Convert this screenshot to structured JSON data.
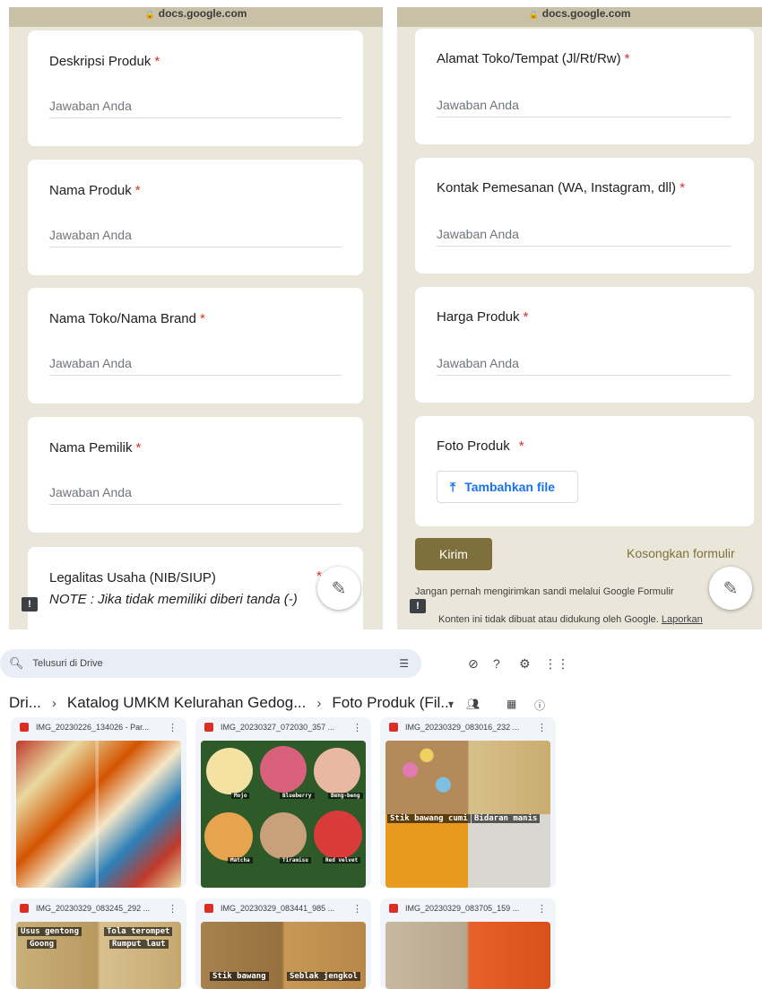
{
  "left_panel": {
    "url": "docs.google.com",
    "questions": [
      {
        "title": "Deskripsi Produk",
        "required": "*",
        "placeholder": "Jawaban Anda"
      },
      {
        "title": "Nama Produk",
        "required": "*",
        "placeholder": "Jawaban Anda"
      },
      {
        "title": "Nama Toko/Nama Brand",
        "required": "*",
        "placeholder": "Jawaban Anda"
      },
      {
        "title": "Nama Pemilik",
        "required": "*",
        "placeholder": "Jawaban Anda"
      }
    ],
    "legalitas": {
      "title": "Legalitas Usaha  (NIB/SIUP)",
      "required": "*",
      "note": "NOTE : Jika tidak memiliki diberi tanda (-)"
    }
  },
  "right_panel": {
    "url": "docs.google.com",
    "questions": [
      {
        "title": "Alamat Toko/Tempat (Jl/Rt/Rw)",
        "required": "*",
        "placeholder": "Jawaban Anda"
      },
      {
        "title": "Kontak Pemesanan (WA, Instagram, dll)",
        "required": "*",
        "placeholder": "Jawaban Anda"
      },
      {
        "title": "Harga Produk",
        "required": "*",
        "placeholder": "Jawaban Anda"
      }
    ],
    "foto": {
      "title": "Foto Produk",
      "required": "*",
      "button_label": "Tambahkan file"
    },
    "submit_label": "Kirim",
    "clear_label": "Kosongkan formulir",
    "footer_line1": "Jangan pernah mengirimkan sandi melalui Google Formulir",
    "footer_line2_text": "Konten ini tidak dibuat atau didukung oleh Google.",
    "footer_line2_link": "Laporkan"
  },
  "drive": {
    "search_placeholder": "Telusuri di Drive",
    "breadcrumb": [
      "Dri...",
      "Katalog UMKM Kelurahan Gedog...",
      "Foto Produk (Fil..."
    ],
    "files": [
      {
        "name": "IMG_20230226_134026 - Par...",
        "captions": []
      },
      {
        "name": "IMG_20230327_072030_357 ...",
        "captions": [
          "Mojo",
          "Blueberry",
          "Beng-beng",
          "Matcha",
          "Tiramisu",
          "Red velvet"
        ]
      },
      {
        "name": "IMG_20230329_083016_232 ...",
        "captions": [
          "Stik bawang cumi",
          "Bidaran manis"
        ]
      },
      {
        "name": "IMG_20230329_083245_292 ...",
        "captions": [
          "Usus gentong",
          "Goong",
          "Tola terompet",
          "Rumput laut"
        ]
      },
      {
        "name": "IMG_20230329_083441_985 ...",
        "captions": [
          "Stik bawang",
          "Seblak jengkol"
        ]
      },
      {
        "name": "IMG_20230329_083705_159 ...",
        "captions": []
      }
    ]
  },
  "colors": {
    "accent_form": "#7f6f3c",
    "form_bg": "#ebe6da",
    "required": "#d93025",
    "link_blue": "#1a73e8"
  }
}
